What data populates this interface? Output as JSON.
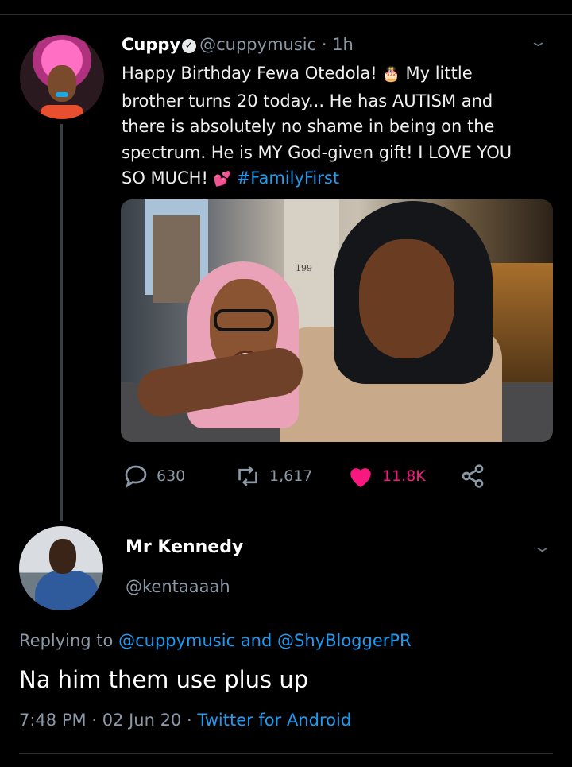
{
  "tweet": {
    "name": "Cuppy",
    "handle": "@cuppymusic",
    "time": "· 1h",
    "text_lines": [
      "Happy Birthday Fewa Otedola!",
      "My little",
      "brother turns 20 today... He has AUTISM and",
      "there is absolutely no shame in being on the",
      "spectrum. He is MY God-given gift! I LOVE YOU",
      "SO MUCH!",
      "#FamilyFirst"
    ],
    "emoji_cake": "🎂",
    "emoji_hearts": "💕",
    "photo_sign": "199",
    "stats": {
      "replies": "630",
      "retweets": "1,617",
      "likes": "11.8K"
    }
  },
  "reply": {
    "name": "Mr Kennedy",
    "handle": "@kentaaaah",
    "replying_prefix": "Replying to",
    "replying_to_1": "@cuppymusic",
    "replying_and": "and",
    "replying_to_2": "@ShyBloggerPR",
    "text": "Na him them use plus up",
    "time": "7:48 PM",
    "date": "02 Jun 20",
    "source": "Twitter for Android",
    "sep": "·"
  },
  "colors": {
    "background": "#000000",
    "link": "#1d9bf0",
    "like": "#f91880",
    "muted": "#8b98a5"
  },
  "icons": [
    "verified-badge-icon",
    "chevron-down-icon",
    "reply-icon",
    "retweet-icon",
    "heart-icon",
    "share-icon"
  ]
}
